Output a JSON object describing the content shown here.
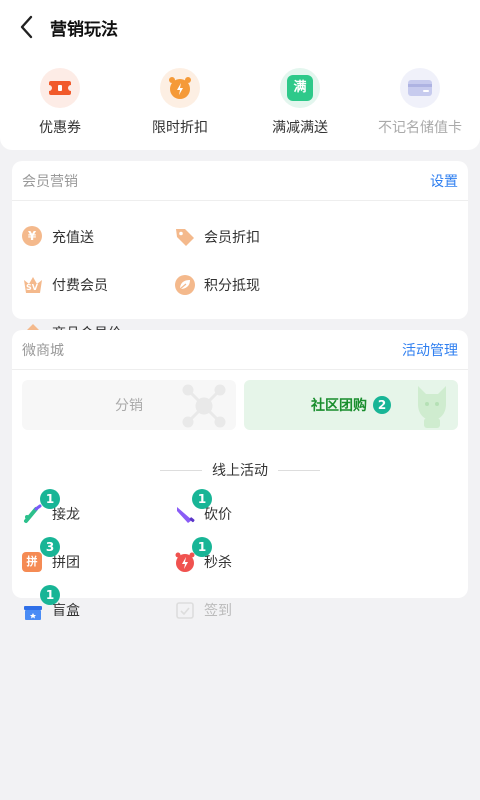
{
  "header": {
    "title": "营销玩法"
  },
  "tools": [
    {
      "label": "优惠券",
      "icon": "coupon-icon"
    },
    {
      "label": "限时折扣",
      "icon": "alarm-clock-icon"
    },
    {
      "label": "满减满送",
      "icon": "full-reduction-icon",
      "icon_text": "满"
    },
    {
      "label": "不记名储值卡",
      "icon": "stored-value-card-icon"
    }
  ],
  "member": {
    "title": "会员营销",
    "action": "设置",
    "items": [
      {
        "label": "充值送",
        "icon": "recharge-icon",
        "icon_text": "¥"
      },
      {
        "label": "会员折扣",
        "icon": "tag-icon"
      },
      {
        "label": "付费会员",
        "icon": "crown-icon",
        "icon_text": "SV"
      },
      {
        "label": "积分抵现",
        "icon": "leaf-icon"
      },
      {
        "label": "商品会员价",
        "icon": "diamond-icon"
      }
    ]
  },
  "mall": {
    "title": "微商城",
    "action": "活动管理",
    "tabs": [
      {
        "label": "分销",
        "active": false
      },
      {
        "label": "社区团购",
        "active": true,
        "count": "2"
      }
    ],
    "section_title": "线上活动",
    "activities": [
      {
        "label": "接龙",
        "icon": "relay-icon",
        "count": "1"
      },
      {
        "label": "砍价",
        "icon": "knife-icon",
        "count": "1"
      },
      {
        "label": "拼团",
        "icon": "group-buy-icon",
        "count": "3",
        "icon_text": "拼"
      },
      {
        "label": "秒杀",
        "icon": "flash-sale-clock-icon",
        "count": "1"
      },
      {
        "label": "盲盒",
        "icon": "gift-box-icon",
        "count": "1"
      },
      {
        "label": "签到",
        "icon": "check-in-icon",
        "disabled": true
      }
    ]
  },
  "colors": {
    "accent": "#2f7ff0",
    "badge": "#18b596",
    "active_tab_bg": "#e6f5e9",
    "active_tab_text": "#1a8e2e"
  }
}
